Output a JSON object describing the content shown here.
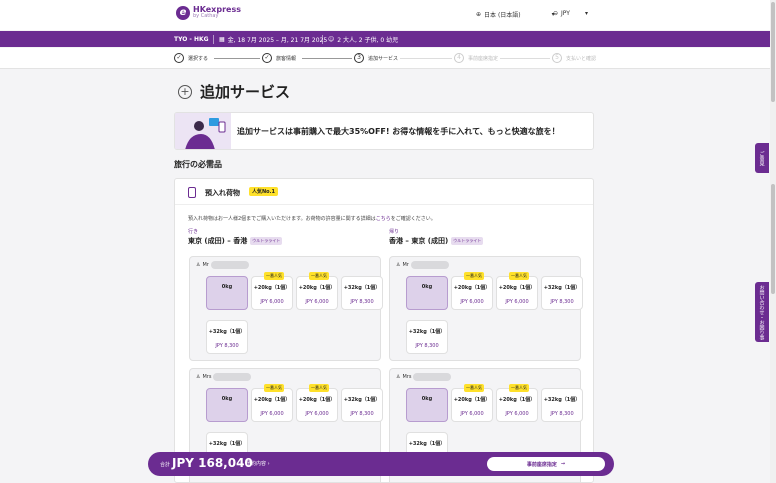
{
  "header": {
    "logo_mark": "e",
    "logo_line1": "HKexpress",
    "logo_line2": "by Cathay",
    "language": "日本 (日本語)",
    "currency": "JPY"
  },
  "trip_bar": {
    "route": "TYO - HKG",
    "dates": "金, 18 7月 2025 – 月, 21 7月 2025",
    "passengers": "2 大人, 2 子供, 0 幼児"
  },
  "steps": [
    {
      "num": "1",
      "label": "選択する",
      "state": "done"
    },
    {
      "num": "2",
      "label": "旅客情報",
      "state": "done"
    },
    {
      "num": "3",
      "label": "追加サービス",
      "state": "current"
    },
    {
      "num": "4",
      "label": "事前座席指定",
      "state": "future"
    },
    {
      "num": "5",
      "label": "支払いと確認",
      "state": "future"
    }
  ],
  "page_title": "追加サービス",
  "promo_text": "追加サービスは事前購入で最大35%OFF! お得な情報を手に入れて、もっと快適な旅を！",
  "section_title": "旅行の必需品",
  "baggage": {
    "title": "預入れ荷物",
    "badge": "人気No.1",
    "note_prefix": "預入れ荷物はお一人様2個までご購入いただけます。お荷物の許容量に関する詳細は",
    "note_link": "こちら",
    "note_suffix": "をご確認ください。",
    "outbound": {
      "dir": "行き",
      "name": "東京 (成田) – 香港",
      "tag": "ウルトラライト"
    },
    "inbound": {
      "dir": "帰り",
      "name": "香港 – 東京 (成田)",
      "tag": "ウルトラライト"
    },
    "popular_label": "一番人気",
    "pax": [
      {
        "title": "Mr"
      },
      {
        "title": "Mr"
      },
      {
        "title": "Mrs"
      },
      {
        "title": "Mrs"
      }
    ],
    "options": [
      {
        "weight": "0kg",
        "price": ""
      },
      {
        "weight": "+20kg（1個）",
        "price": "JPY 6,000"
      },
      {
        "weight": "+20kg（1個）",
        "price": "JPY 6,000"
      },
      {
        "weight": "+32kg（1個）",
        "price": "JPY 8,300"
      },
      {
        "weight": "+32kg（1個）",
        "price": "JPY 8,300"
      }
    ]
  },
  "bottom_bar": {
    "total_label": "合計",
    "total": "JPY 168,040",
    "detail": "予約内容 ›",
    "cta": "事前座席指定"
  },
  "side_tabs": [
    "ご意見",
    "お問い合わせ・お困り事"
  ],
  "colors": {
    "brand": "#6b2c91",
    "highlight": "#ffe12b"
  }
}
